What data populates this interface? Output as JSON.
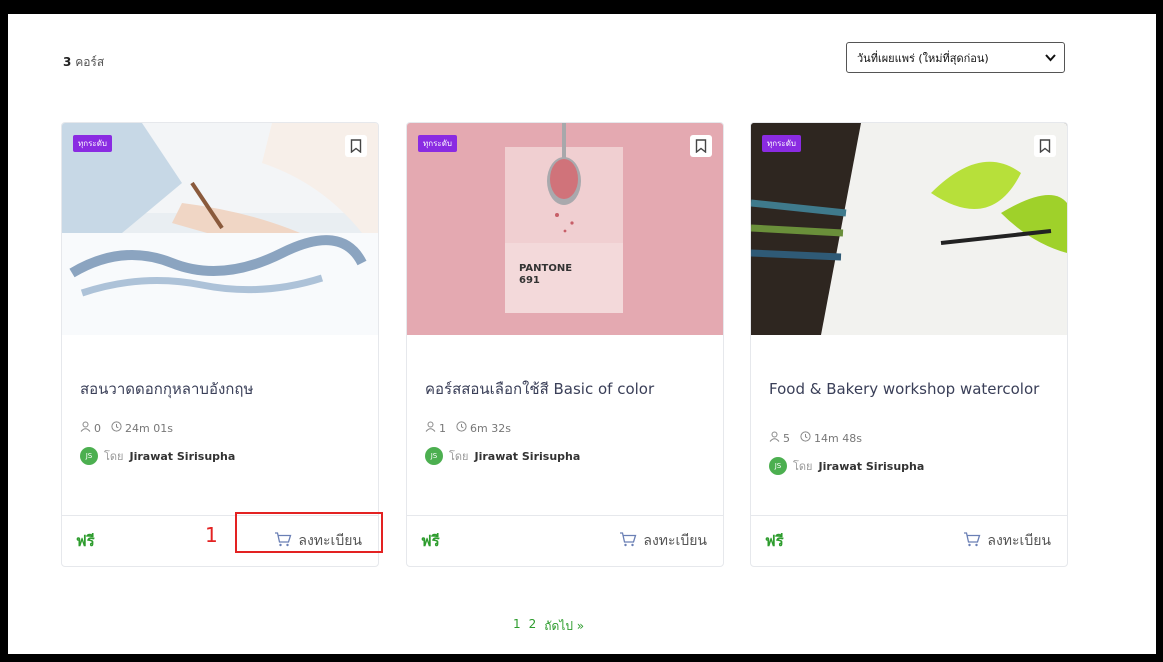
{
  "header": {
    "course_count": "3",
    "course_count_label": "คอร์ส",
    "sort_value": "วันที่เผยแพร่ (ใหม่ที่สุดก่อน)"
  },
  "courses": [
    {
      "badge": "ทุกระดับ",
      "title": "สอนวาดดอกกุหลาบอังกฤษ",
      "students": "0",
      "duration": "24m 01s",
      "avatar_initials": "JS",
      "by_label": "โดย",
      "author": "Jirawat Sirisupha",
      "price": "ฟรี",
      "enroll_label": "ลงทะเบียน"
    },
    {
      "badge": "ทุกระดับ",
      "title": "คอร์สสอนเลือกใช้สี Basic of color",
      "students": "1",
      "duration": "6m 32s",
      "avatar_initials": "JS",
      "by_label": "โดย",
      "author": "Jirawat Sirisupha",
      "price": "ฟรี",
      "enroll_label": "ลงทะเบียน",
      "image_text": "PANTONE 691"
    },
    {
      "badge": "ทุกระดับ",
      "title": "Food & Bakery workshop watercolor",
      "students": "5",
      "duration": "14m 48s",
      "avatar_initials": "JS",
      "by_label": "โดย",
      "author": "Jirawat Sirisupha",
      "price": "ฟรี",
      "enroll_label": "ลงทะเบียน"
    }
  ],
  "annotation": {
    "marker": "1"
  },
  "pagination": {
    "page1": "1",
    "page2": "2",
    "next": "ถัดไป »"
  },
  "colors": {
    "badge": "#8a2be2",
    "price": "#2d9c2d",
    "highlight": "#e32222"
  }
}
